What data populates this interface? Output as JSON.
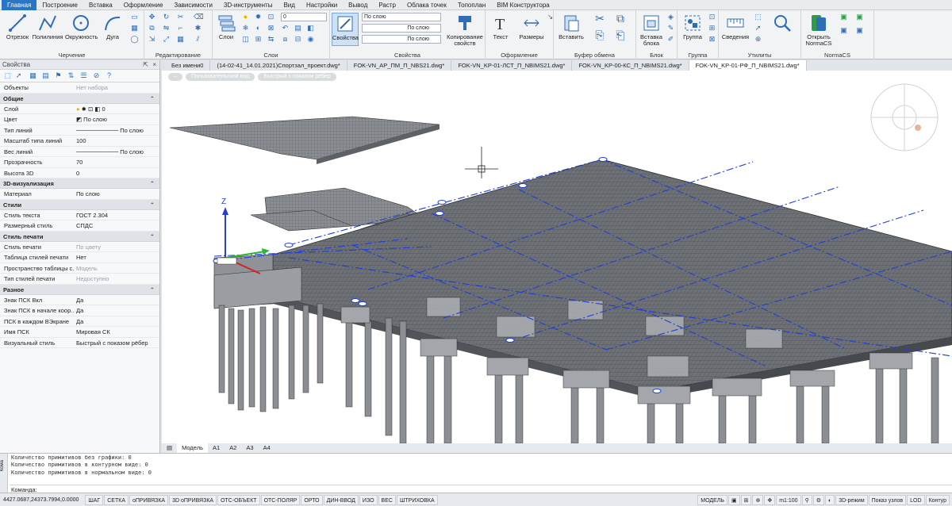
{
  "menu": [
    "Главная",
    "Построение",
    "Вставка",
    "Оформление",
    "Зависимости",
    "3D-инструменты",
    "Вид",
    "Настройки",
    "Вывод",
    "Растр",
    "Облака точек",
    "Топоплан",
    "BIM Конструктора"
  ],
  "ribbon": {
    "draw": {
      "label": "Черчение",
      "line": "Отрезок",
      "polyline": "Полилиния",
      "circle": "Окружность",
      "arc": "Дуга"
    },
    "edit": {
      "label": "Редактирование"
    },
    "layers": {
      "label": "Слои",
      "layers_btn": "Слои",
      "layer_value": "0"
    },
    "props": {
      "label": "Свойства",
      "props_btn": "Свойства",
      "color": "По слою",
      "ltype": "По слою",
      "lweight": "По слою",
      "copy_props": "Копирование свойств"
    },
    "annot": {
      "label": "Оформление",
      "text": "Текст",
      "dims": "Размеры"
    },
    "clip": {
      "label": "Буфер обмена",
      "paste": "Вставить"
    },
    "block": {
      "label": "Блок",
      "insert": "Вставка блока"
    },
    "group": {
      "label": "Группа",
      "group": "Группа"
    },
    "utils": {
      "label": "Утилиты",
      "info": "Сведения"
    },
    "normacs": {
      "label": "NormaCS",
      "open": "Открыть NormaCS"
    }
  },
  "properties": {
    "title": "Свойства",
    "objects_key": "Объекты",
    "objects_val": "Нет набора",
    "sections": [
      {
        "name": "Общие",
        "rows": [
          {
            "k": "Слой",
            "v": "0"
          },
          {
            "k": "Цвет",
            "v": "По слою"
          },
          {
            "k": "Тип линий",
            "v": "По слою"
          },
          {
            "k": "Масштаб типа линий",
            "v": "100"
          },
          {
            "k": "Вес линий",
            "v": "По слою"
          },
          {
            "k": "Прозрачность",
            "v": "70"
          },
          {
            "k": "Высота 3D",
            "v": "0"
          }
        ]
      },
      {
        "name": "3D-визуализация",
        "rows": [
          {
            "k": "Материал",
            "v": "По слою"
          }
        ]
      },
      {
        "name": "Стили",
        "rows": [
          {
            "k": "Стиль текста",
            "v": "ГОСТ 2.304"
          },
          {
            "k": "Размерный стиль",
            "v": "СПДС"
          }
        ]
      },
      {
        "name": "Стиль печати",
        "rows": [
          {
            "k": "Стиль печати",
            "v": "По цвету",
            "dim": true
          },
          {
            "k": "Таблица стилей печати",
            "v": "Нет"
          },
          {
            "k": "Пространство таблицы с...",
            "v": "Модель",
            "dim": true
          },
          {
            "k": "Тип стилей печати",
            "v": "Недоступно",
            "dim": true
          }
        ]
      },
      {
        "name": "Разное",
        "rows": [
          {
            "k": "Знак ПСК Вкл",
            "v": "Да"
          },
          {
            "k": "Знак ПСК в начале коор...",
            "v": "Да"
          },
          {
            "k": "ПСК в каждом ВЭкране",
            "v": "Да"
          },
          {
            "k": "Имя ПСК",
            "v": "Мировая СК"
          },
          {
            "k": "Визуальный стиль",
            "v": "Быстрый с показом рёбер"
          }
        ]
      }
    ]
  },
  "doc_tabs": [
    "Без имени0",
    "(14-02-41_14.01.2021)Спортзал_проект.dwg*",
    "FOK-VN_AP_ПМ_П_NBS21.dwg*",
    "FOK-VN_KP-01-ЛСТ_П_NBIMS21.dwg*",
    "FOK-VN_KP-00-КС_П_NBIMS21.dwg*",
    "FOK-VN_KP-01-РФ_П_NBIMS21.dwg*"
  ],
  "viewport": {
    "view_btn": "Пользовательский вид",
    "style_btn": "Быстрый с показом рёбер",
    "axis_z": "Z"
  },
  "layout_tabs": [
    "Модель",
    "A1",
    "A2",
    "A3",
    "A4"
  ],
  "command_lines": [
    "Количество примитивов без графики: 0",
    "Количество примитивов в контурном виде: 0",
    "Количество примитивов в нормальном виде: 0"
  ],
  "command_prompt": "Команда:",
  "command_side": "Кома",
  "status": {
    "coords": "4427.0687,24373.7994,0.0000",
    "toggles": [
      "ШАГ",
      "СЕТКА",
      "оПРИВЯЗКА",
      "3D оПРИВЯЗКА",
      "ОТС-ОБЪЕКТ",
      "ОТС-ПОЛЯР",
      "ОРТО",
      "ДИН-ВВОД",
      "ИЗО",
      "ВЕС",
      "ШТРИХОВКА"
    ],
    "model": "МОДЕЛЬ",
    "scale": "m1:100",
    "mode3d": "3D-режим",
    "nodes": "Показ узлов",
    "lod": "LOD",
    "contour": "Контур"
  },
  "colors": {
    "accent": "#2a76c6",
    "grid_lines": "#1f3fd6",
    "structure": "#5a5d61"
  }
}
